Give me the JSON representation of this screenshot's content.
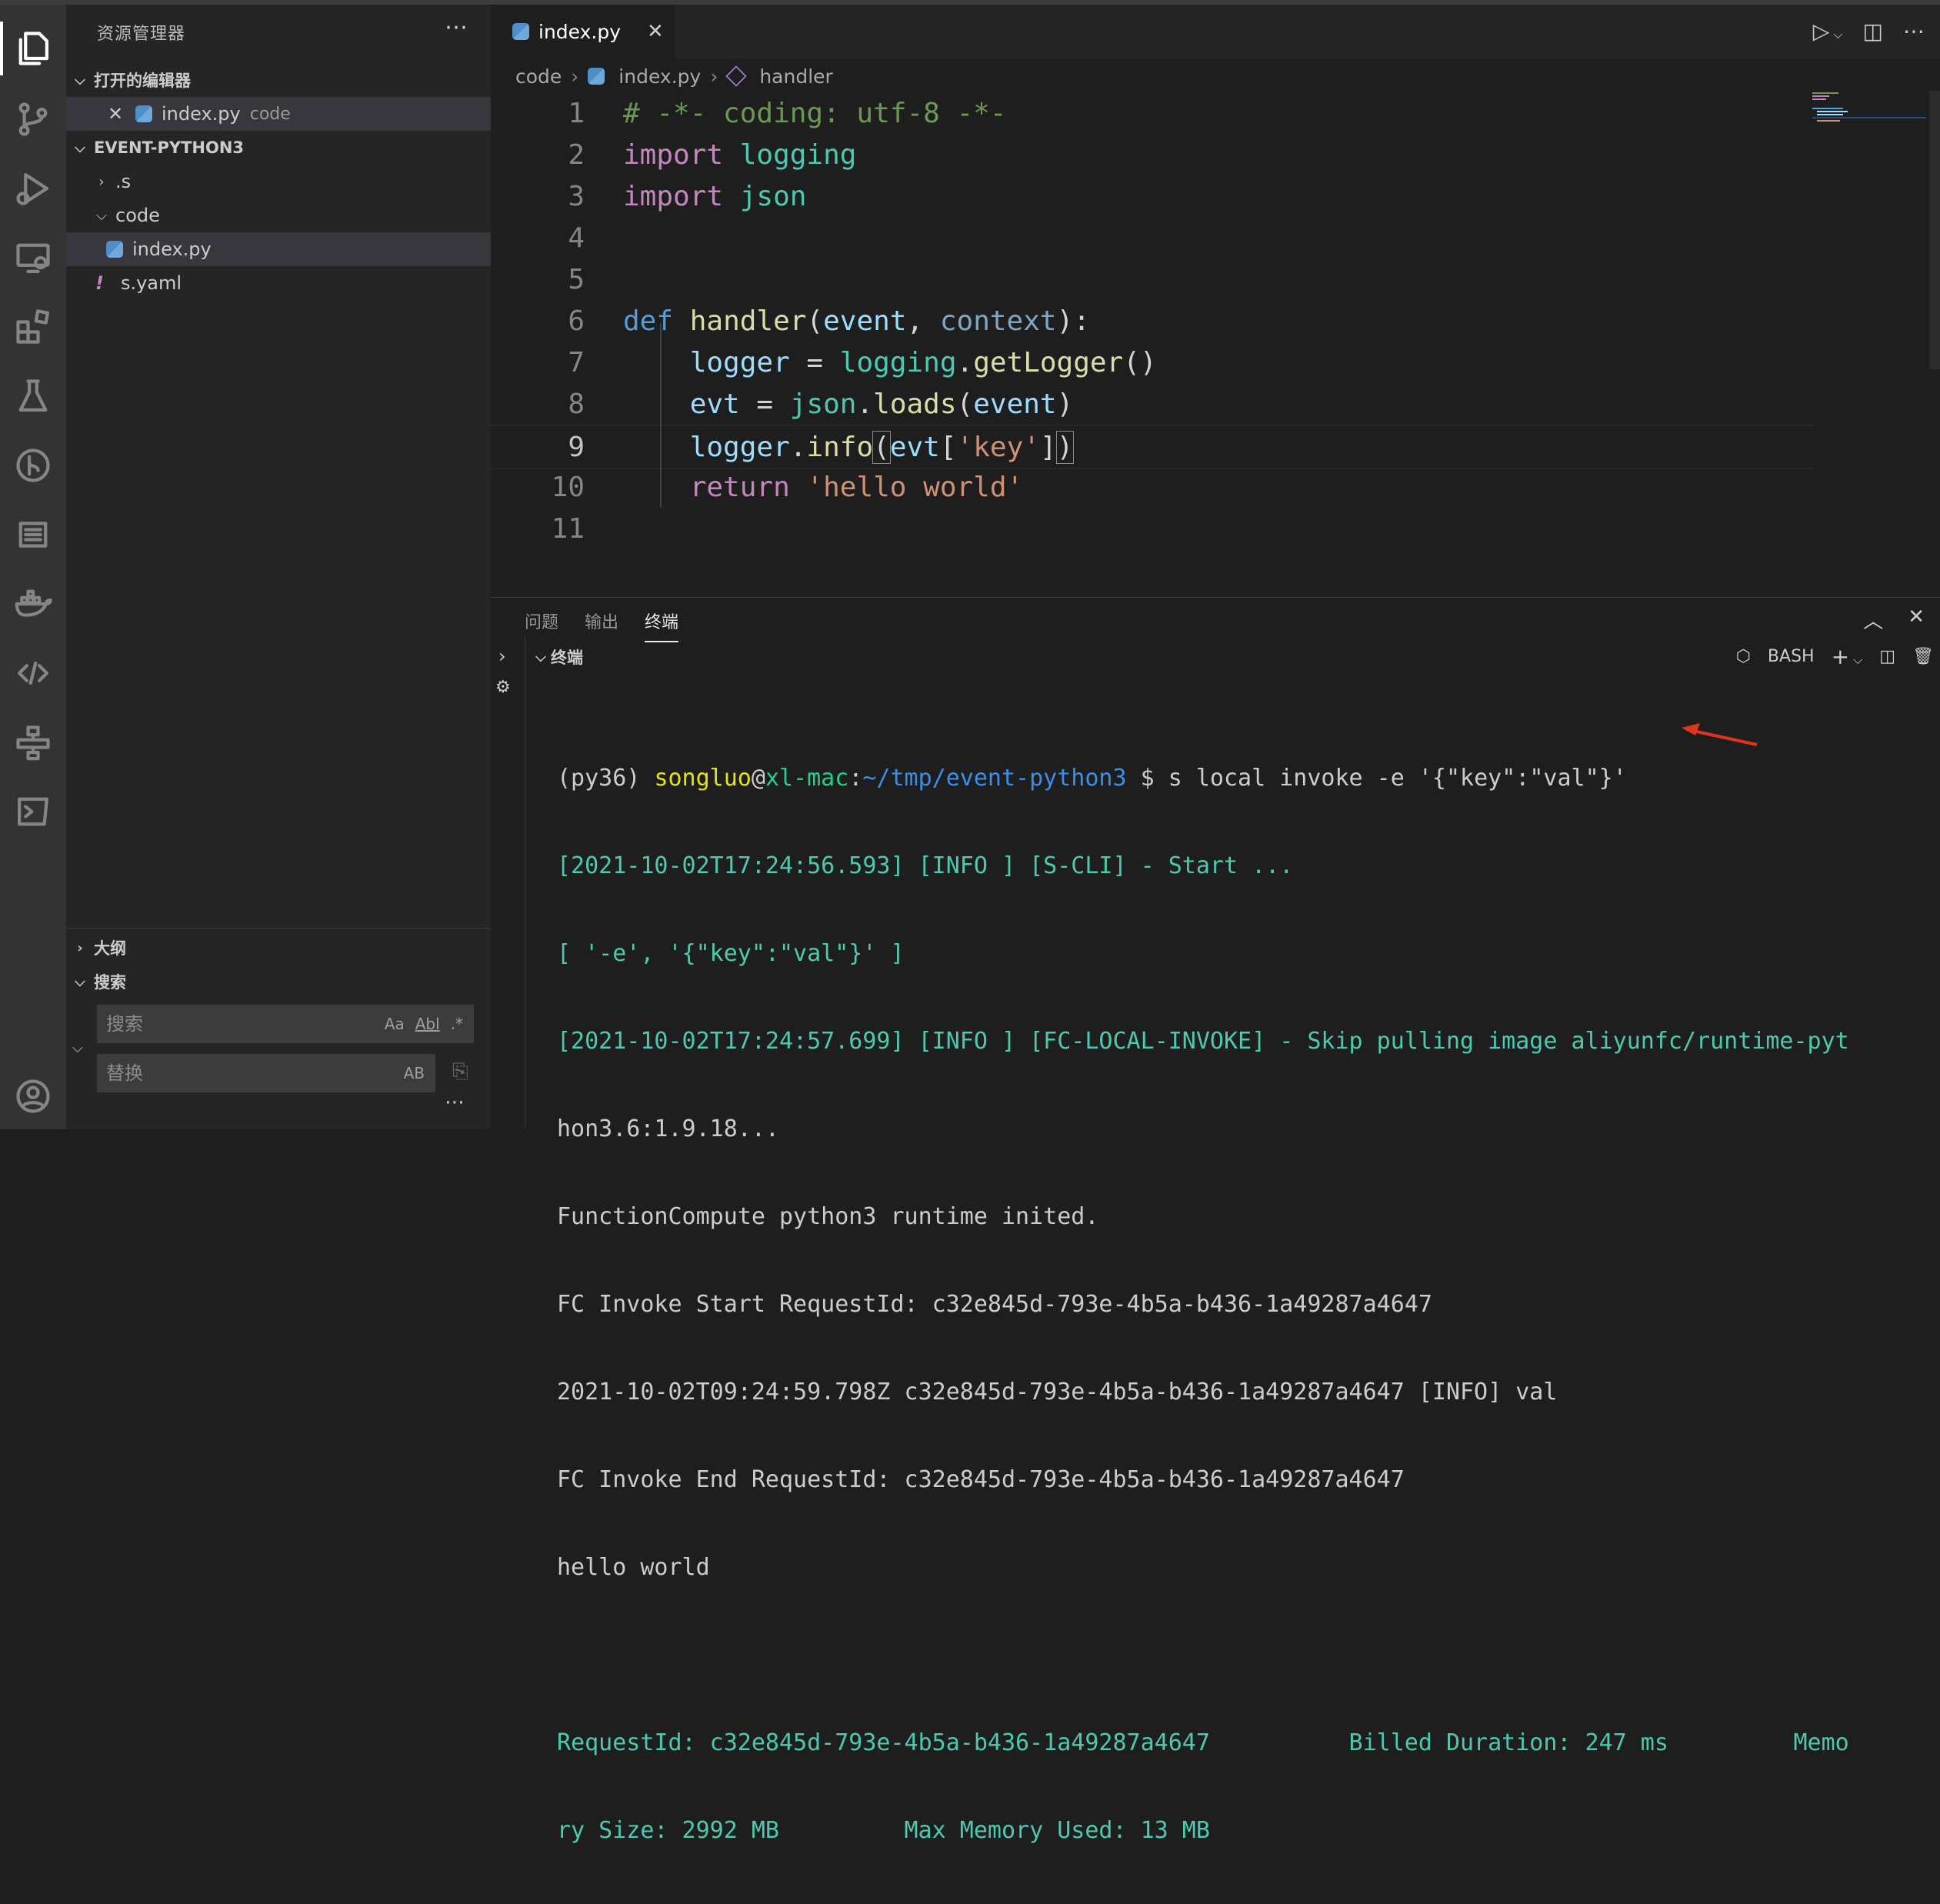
{
  "sidebar": {
    "title": "资源管理器",
    "open_editors_label": "打开的编辑器",
    "open_editor_file": "index.py",
    "open_editor_folder": "code",
    "project_label": "EVENT-PYTHON3",
    "tree": [
      {
        "name": ".s",
        "kind": "folder"
      },
      {
        "name": "code",
        "kind": "folder"
      },
      {
        "name": "index.py",
        "kind": "python"
      },
      {
        "name": "s.yaml",
        "kind": "yaml"
      }
    ],
    "outline_label": "大纲",
    "search_label": "搜索",
    "search_placeholder": "搜索",
    "replace_placeholder": "替换",
    "opt_case": "Aa",
    "opt_word": "Abl",
    "opt_regex": ".*",
    "opt_preserve": "AB"
  },
  "editor": {
    "tab_label": "index.py",
    "breadcrumb": [
      "code",
      "index.py",
      "handler"
    ],
    "lines": [
      {
        "n": "1",
        "text": "# -*- coding: utf-8 -*-"
      },
      {
        "n": "2",
        "text": "import logging"
      },
      {
        "n": "3",
        "text": "import json"
      },
      {
        "n": "4",
        "text": ""
      },
      {
        "n": "5",
        "text": ""
      },
      {
        "n": "6",
        "text": "def handler(event, context):"
      },
      {
        "n": "7",
        "text": "    logger = logging.getLogger()"
      },
      {
        "n": "8",
        "text": "    evt = json.loads(event)"
      },
      {
        "n": "9",
        "text": "    logger.info(evt['key'])"
      },
      {
        "n": "10",
        "text": "    return 'hello world'"
      },
      {
        "n": "11",
        "text": ""
      }
    ]
  },
  "panel": {
    "tabs": [
      "问题",
      "输出",
      "终端"
    ],
    "terminal_label": "终端",
    "shell": "BASH",
    "lines": [
      "[2021-10-02T17:24:56.593] [INFO ] [S-CLI] - Start ...",
      "[ '-e', '{\"key\":\"val\"}' ]",
      "[2021-10-02T17:24:57.699] [INFO ] [FC-LOCAL-INVOKE] - Skip pulling image aliyunfc/runtime-pyt",
      "hon3.6:1.9.18...",
      "FunctionCompute python3 runtime inited.",
      "FC Invoke Start RequestId: c32e845d-793e-4b5a-b436-1a49287a4647",
      "2021-10-02T09:24:59.798Z c32e845d-793e-4b5a-b436-1a49287a4647 [INFO] val",
      "FC Invoke End RequestId: c32e845d-793e-4b5a-b436-1a49287a4647",
      "hello world",
      "",
      "RequestId: c32e845d-793e-4b5a-b436-1a49287a4647          Billed Duration: 247 ms         Memo",
      "ry Size: 2992 MB         Max Memory Used: 13 MB"
    ],
    "prompt": {
      "env": "(py36) ",
      "user": "songluo",
      "at": "@",
      "host": "xl-mac",
      "colon": ":",
      "path": "~/tmp/event-python3",
      "cmd": " $ s local invoke -e '{\"key\":\"val\"}'"
    }
  }
}
